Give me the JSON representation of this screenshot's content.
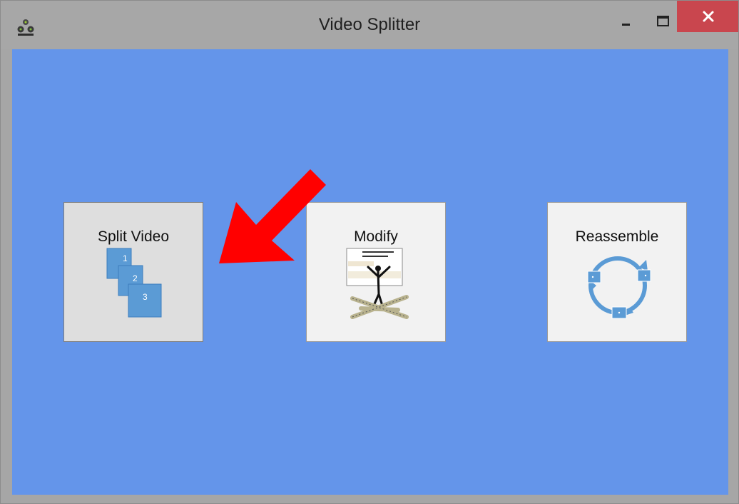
{
  "window": {
    "title": "Video Splitter",
    "icons": {
      "app": "film-reel-icon",
      "minimize": "minimize-icon",
      "maximize": "maximize-icon",
      "close": "close-icon"
    }
  },
  "tiles": [
    {
      "label": "Split Video",
      "icon": "numbered-stack-icon",
      "numbers": [
        "1",
        "2",
        "3"
      ],
      "state": "hovered"
    },
    {
      "label": "Modify",
      "icon": "clip-art-figure-icon"
    },
    {
      "label": "Reassemble",
      "icon": "cycle-icon"
    }
  ],
  "annotation": {
    "icon": "red-arrow-icon",
    "points_to": "Split Video"
  },
  "colors": {
    "client_bg": "#6495ea",
    "titlebar_bg": "#a7a7a7",
    "close_bg": "#c9464e",
    "tile_bg": "#f2f2f2",
    "tile_active_bg": "#dedede",
    "icon_blue": "#5b9bd5",
    "arrow_red": "#ff0000"
  }
}
